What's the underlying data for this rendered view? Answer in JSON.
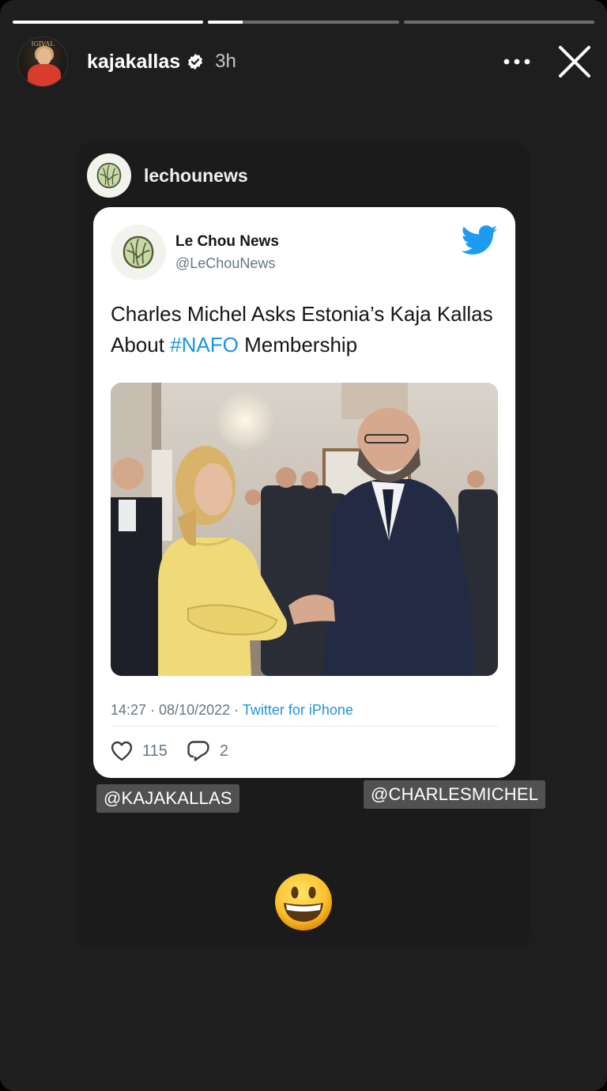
{
  "story": {
    "progress": [
      1.0,
      0.18,
      0.0
    ],
    "username": "kajakallas",
    "timestamp": "3h",
    "avatar_crest_text": "RIIGIVALITSUS"
  },
  "shared_post": {
    "username": "lechounews"
  },
  "tweet": {
    "display_name": "Le Chou News",
    "handle": "@LeChouNews",
    "text_before": "Charles Michel Asks Estonia’s Kaja Kallas About ",
    "hashtag": "#NAFO",
    "text_after": " Membership",
    "time": "14:27 · 08/10/2022 · ",
    "source": "Twitter for iPhone",
    "likes": "115",
    "replies": "2"
  },
  "mentions": {
    "left": "@KAJAKALLAS",
    "right": "@CHARLESMICHEL"
  },
  "colors": {
    "twitter_blue": "#1b95e0",
    "story_bg": "#1e1e1e"
  },
  "icons": [
    "verified-icon",
    "more-icon",
    "close-icon",
    "cabbage-icon",
    "twitter-bird-icon",
    "heart-icon",
    "reply-icon",
    "grinning-emoji-icon"
  ]
}
